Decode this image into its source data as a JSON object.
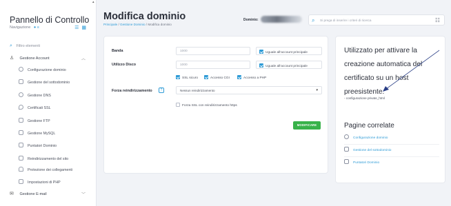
{
  "sidebar": {
    "brand": "Pannello di Controllo",
    "nav_label": "Navigazione",
    "nav_dots": "● ≡",
    "filter_placeholder": "Filtro elementi",
    "section_account": "Gestione Account",
    "items": [
      {
        "label": "Configurazione dominio"
      },
      {
        "label": "Gestione del sottodominio"
      },
      {
        "label": "Gestione DNS"
      },
      {
        "label": "Certificati SSL"
      },
      {
        "label": "Gestione FTP"
      },
      {
        "label": "Gestione MySQL"
      },
      {
        "label": "Puntatori Dominio"
      },
      {
        "label": "Reindirizzamento del sito"
      },
      {
        "label": "Protezione dei collegamenti"
      },
      {
        "label": "Impostazioni di PHP"
      }
    ],
    "section_email": "Gestione E-mail"
  },
  "header": {
    "title": "Modifica dominio",
    "breadcrumb_home": "Principale",
    "breadcrumb_mid": "Gestione Dominio",
    "breadcrumb_current": "Modifica dominio",
    "domain_label": "Dominio:",
    "search_placeholder": "Si prega di inserire i criteri di ricerca"
  },
  "form": {
    "banda_label": "Banda",
    "banda_value": "1000",
    "banda_same_label": "Uguale all'account principale",
    "disco_label": "Utilizzo Disco",
    "disco_value": "1000",
    "disco_same_label": "Uguale all'account principale",
    "ssl_label": "SSL sicuro",
    "cgi_label": "Accesso CGI",
    "php_label": "Accesso a PHP",
    "forza_label": "Forza reindirizzamento",
    "help_icon": "?",
    "redirect_select": "Nessun reindirizzamento",
    "force_ssl_label": "Forza SSL con reindirizzamento https",
    "submit_label": "MODIFICARE"
  },
  "help_panel": {
    "text": "Utilizzato per attivare la creazione automatica del certificato su un host preesistente.",
    "config_ref": "- configurazione private_html",
    "related_title": "Pagine correlate",
    "related": [
      {
        "label": "Configurazione dominio"
      },
      {
        "label": "Gestione del sottodominio"
      },
      {
        "label": "Puntatori Dominio"
      }
    ]
  },
  "colors": {
    "accent": "#2e9bd6",
    "success": "#38b24a",
    "annotation_arrow": "#2a3f86"
  }
}
